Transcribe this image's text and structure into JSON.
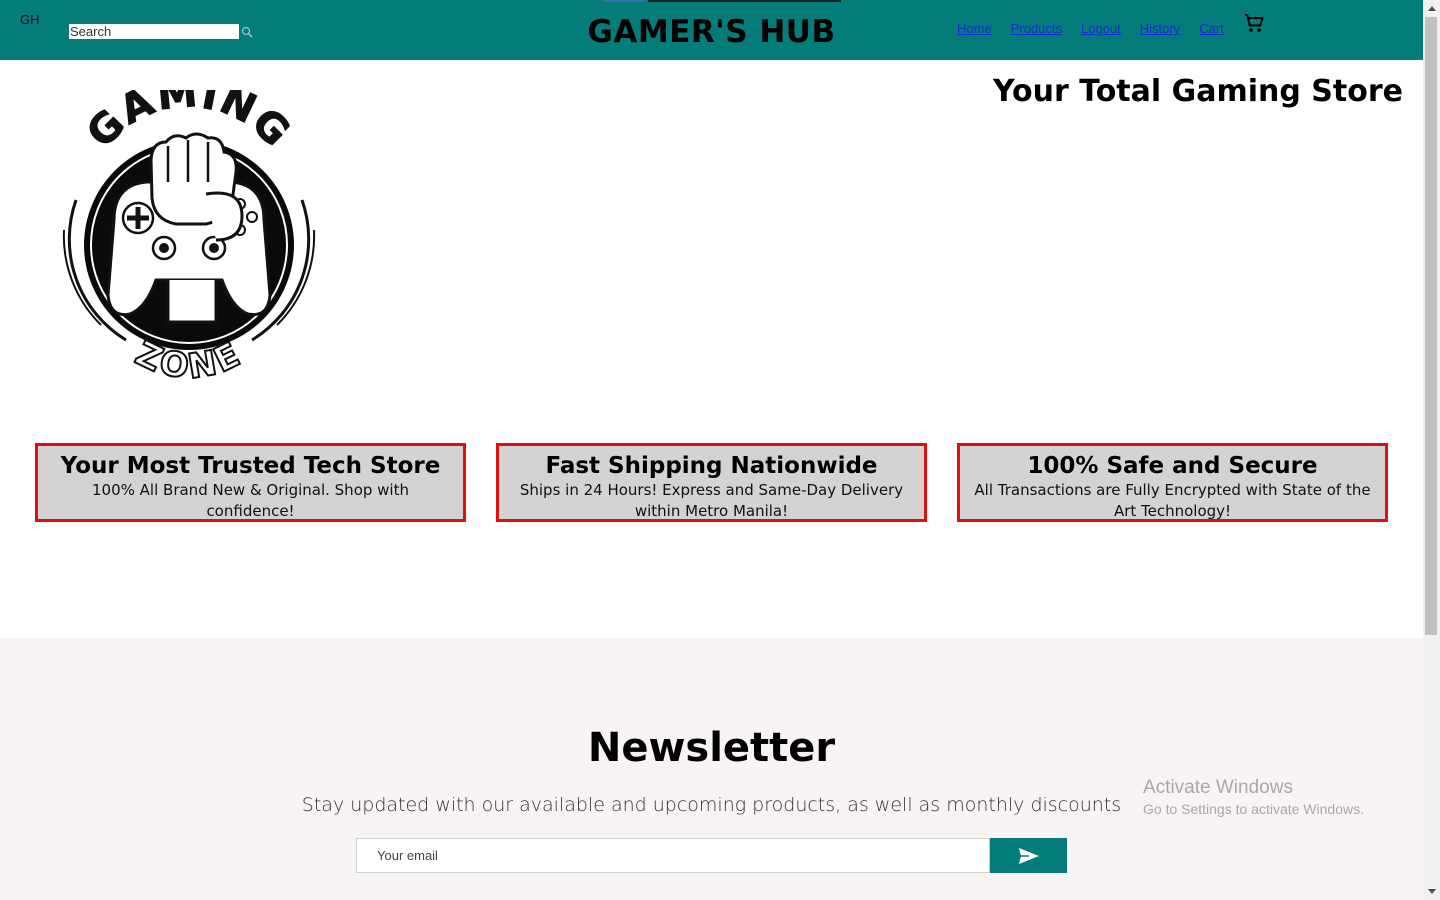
{
  "header": {
    "brand_initials": "GH",
    "search_placeholder": "Search",
    "site_title": "GAMER'S HUB",
    "nav": [
      "Home",
      "Products",
      "Logout",
      "History",
      "Cart"
    ],
    "background_color": "#037c7a"
  },
  "hero": {
    "tagline": "Your Total Gaming Store",
    "logo_text_top": "GAMING",
    "logo_text_bottom": "ZONE"
  },
  "features": [
    {
      "title": "Your Most Trusted Tech Store",
      "text": "100% All Brand New & Original. Shop with confidence!"
    },
    {
      "title": "Fast Shipping Nationwide",
      "text": "Ships in 24 Hours! Express and Same-Day Delivery within Metro Manila!"
    },
    {
      "title": "100% Safe and Secure",
      "text": "All Transactions are Fully Encrypted with State of the Art Technology!"
    }
  ],
  "newsletter": {
    "title": "Newsletter",
    "subtitle": "Stay updated with our available and upcoming products, as well as monthly discounts",
    "email_placeholder": "Your email"
  },
  "watermark": {
    "line1": "Activate Windows",
    "line2": "Go to Settings to activate Windows."
  },
  "icons": {
    "search": "search-icon",
    "cart": "cart-icon",
    "send": "send-icon"
  },
  "colors": {
    "accent": "#037c7a",
    "feature_border": "#e01010",
    "feature_background": "#d3d3d3"
  }
}
